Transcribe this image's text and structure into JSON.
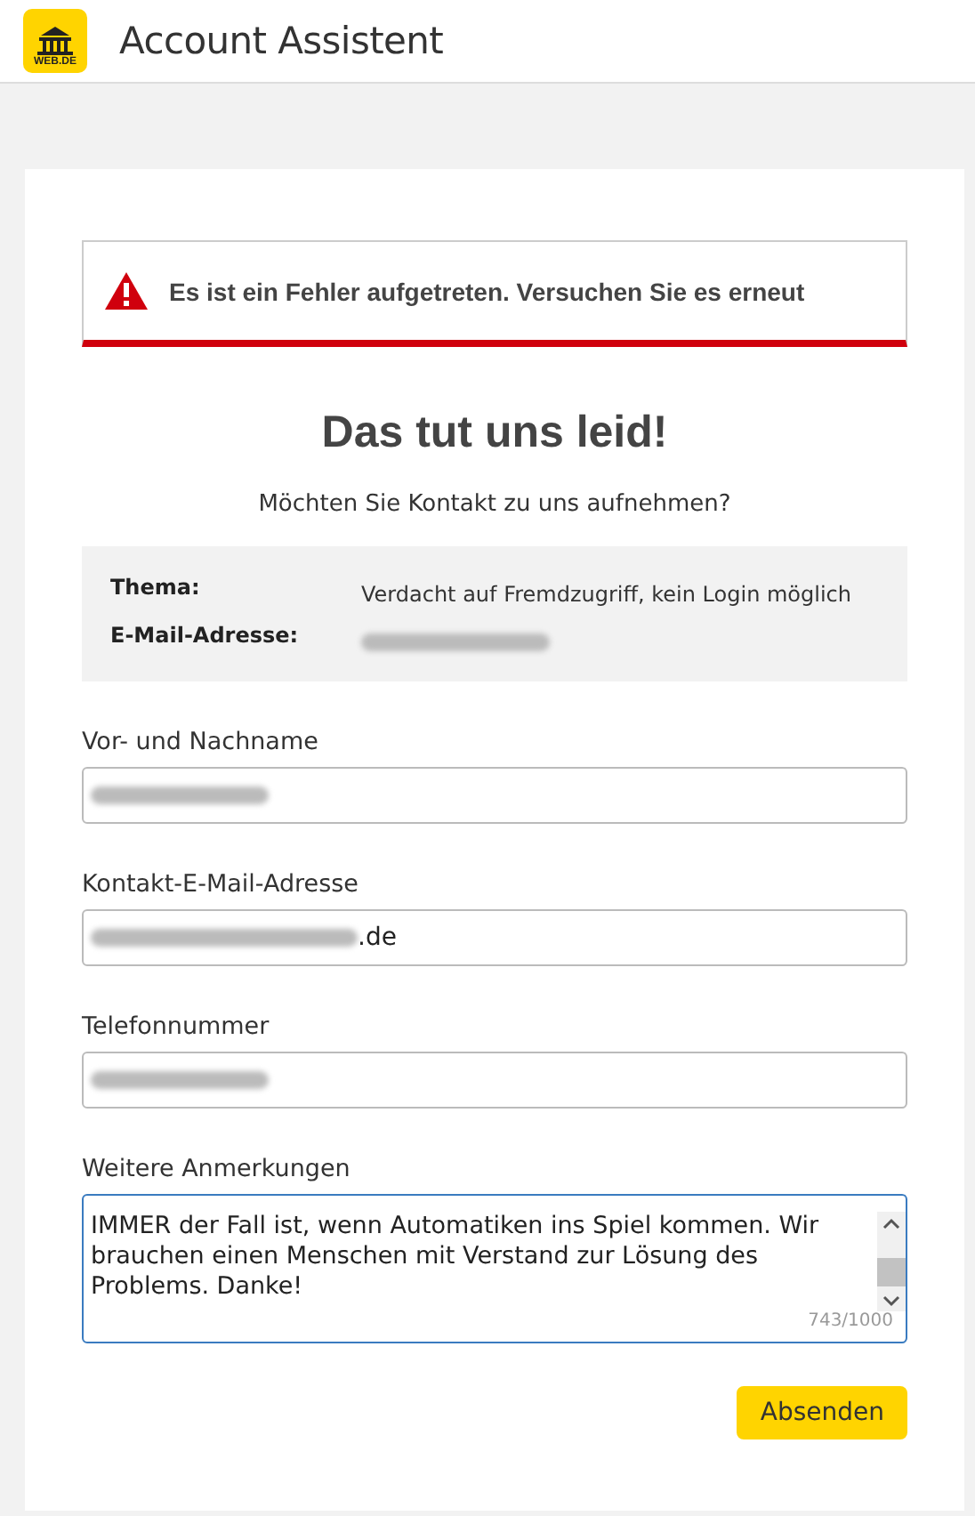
{
  "header": {
    "logo_text": "WEB.DE",
    "title": "Account Assistent"
  },
  "error": {
    "message": "Es ist ein Fehler aufgetreten. Versuchen Sie es erneut"
  },
  "heading": "Das tut uns leid!",
  "subtitle": "Möchten Sie Kontakt zu uns aufnehmen?",
  "info": [
    {
      "label": "Thema:",
      "value": "Verdacht auf Fremdzugriff, kein Login möglich",
      "redacted": false
    },
    {
      "label": "E-Mail-Adresse:",
      "redacted": true
    }
  ],
  "fields": [
    {
      "label": "Vor- und Nachname",
      "redacted": true
    },
    {
      "label": "Kontakt-E-Mail-Adresse",
      "value": ".de",
      "redacted": true
    },
    {
      "label": "Telefonnummer",
      "redacted": true
    }
  ],
  "remarks": {
    "label": "Weitere Anmerkungen",
    "value": "IMMER der Fall ist, wenn Automatiken ins Spiel kommen. Wir brauchen einen Menschen mit Verstand zur Lösung des Problems. Danke!",
    "counter": "743/1000"
  },
  "submit": "Absenden"
}
